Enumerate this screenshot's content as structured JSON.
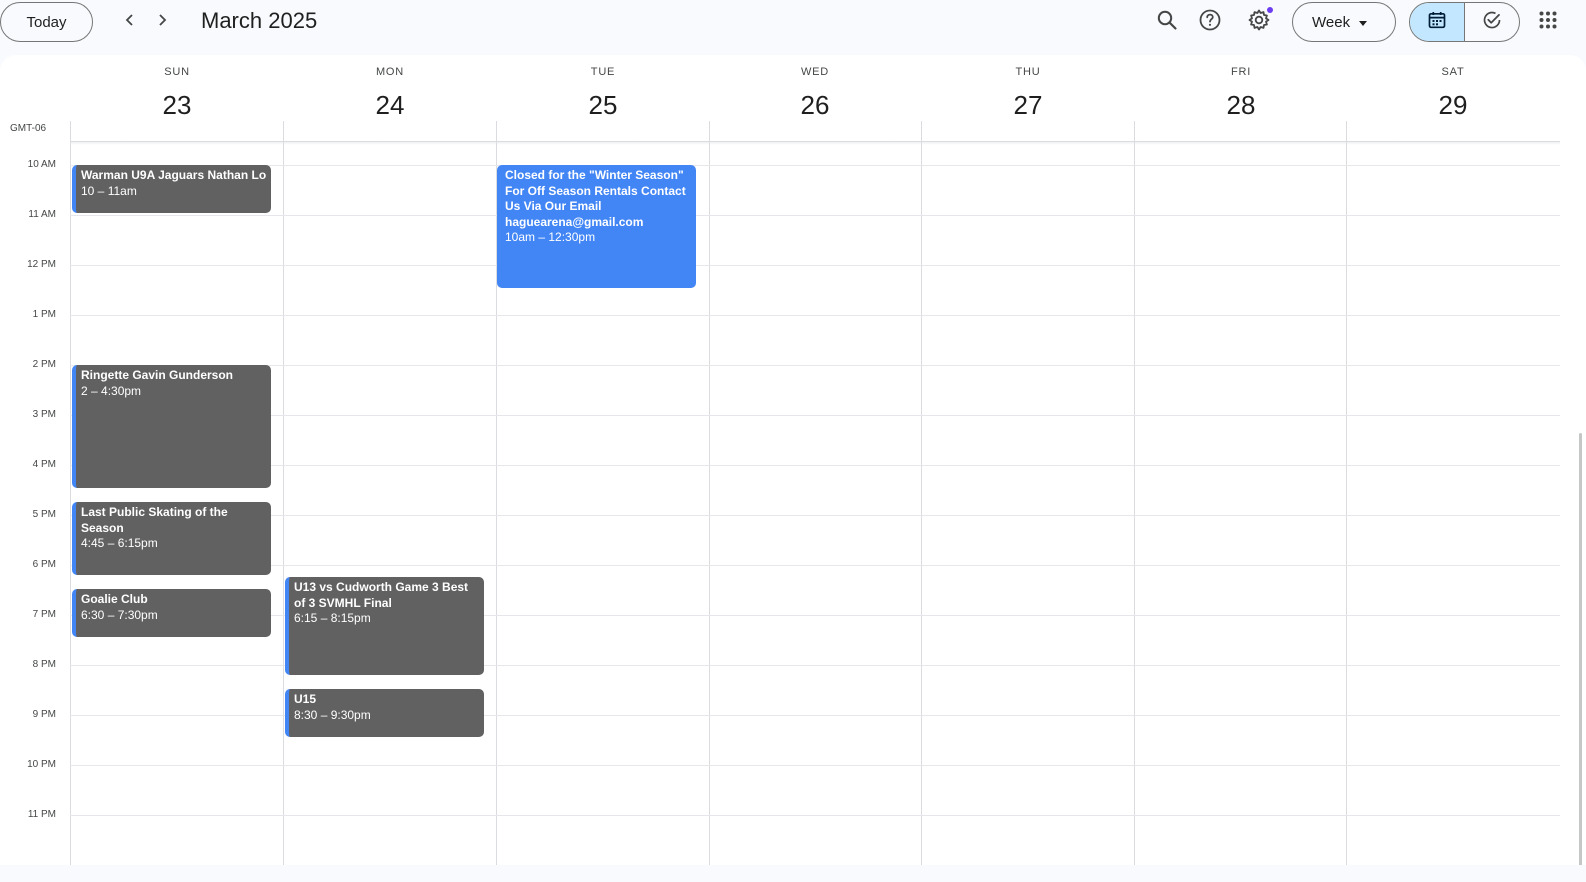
{
  "toolbar": {
    "today_label": "Today",
    "prev_icon": "chevron-left-icon",
    "next_icon": "chevron-right-icon",
    "month_title": "March 2025",
    "view_select_value": "Week",
    "search_icon": "search-icon",
    "help_icon": "help-icon",
    "settings_icon": "settings-icon",
    "calendar_view_icon": "calendar-icon",
    "tasks_view_icon": "task-check-icon",
    "apps_icon": "apps-grid-icon"
  },
  "timezone": "GMT-06",
  "days": [
    {
      "dow": "SUN",
      "num": "23"
    },
    {
      "dow": "MON",
      "num": "24"
    },
    {
      "dow": "TUE",
      "num": "25"
    },
    {
      "dow": "WED",
      "num": "26"
    },
    {
      "dow": "THU",
      "num": "27"
    },
    {
      "dow": "FRI",
      "num": "28"
    },
    {
      "dow": "SAT",
      "num": "29"
    }
  ],
  "hours": [
    "10 AM",
    "11 AM",
    "12 PM",
    "1 PM",
    "2 PM",
    "3 PM",
    "4 PM",
    "5 PM",
    "6 PM",
    "7 PM",
    "8 PM",
    "9 PM",
    "10 PM",
    "11 PM"
  ],
  "events": [
    {
      "title": "Warman U9A Jaguars Nathan Lo",
      "time": "10 – 11am",
      "day": "SUN"
    },
    {
      "title": "Ringette Gavin Gunderson",
      "time": "2 – 4:30pm",
      "day": "SUN"
    },
    {
      "title": "Last Public Skating of the Season",
      "time": "4:45 – 6:15pm",
      "day": "SUN"
    },
    {
      "title": "Goalie Club",
      "time": "6:30 – 7:30pm",
      "day": "SUN"
    },
    {
      "title": "U13 vs Cudworth Game 3 Best of 3 SVMHL Final",
      "time": "6:15 – 8:15pm",
      "day": "MON"
    },
    {
      "title": "U15",
      "time": "8:30 – 9:30pm",
      "day": "MON"
    },
    {
      "title": "Closed for the \"Winter Season\" For Off Season Rentals Contact Us Via Our Email haguearena@gmail.com",
      "time": "10am – 12:30pm",
      "day": "TUE"
    }
  ],
  "colors": {
    "accent": "#4285f4",
    "event_grey": "#616161",
    "selected_segment": "#c2e7ff",
    "notification_dot": "#6d3df0"
  }
}
